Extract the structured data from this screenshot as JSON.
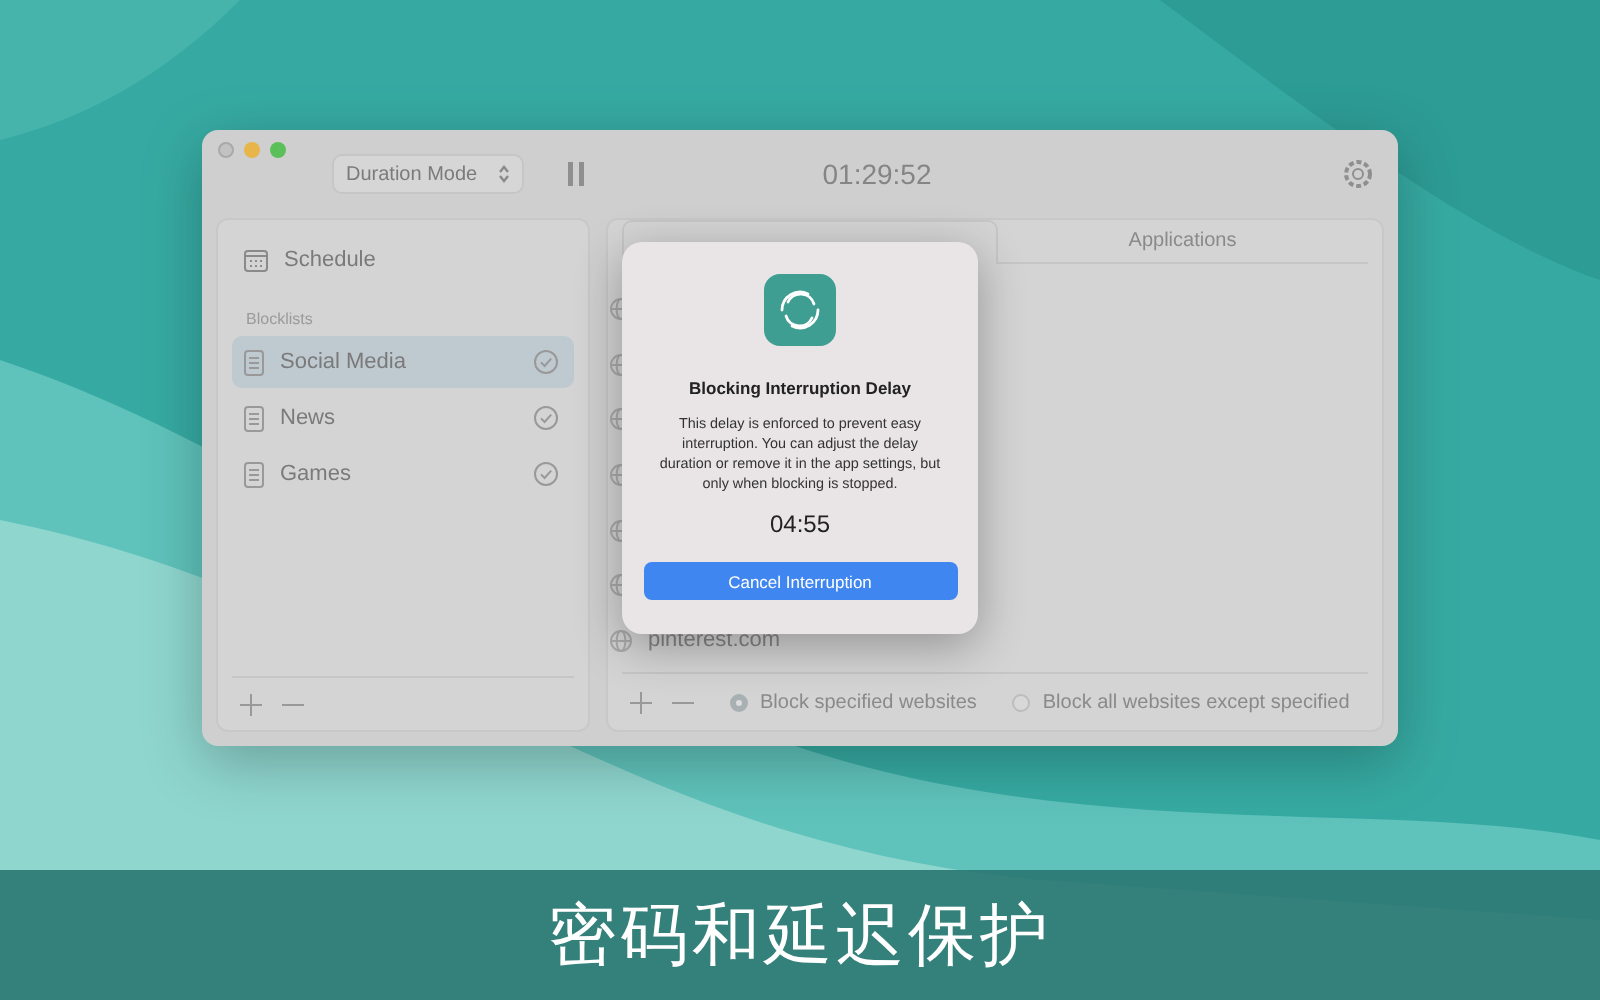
{
  "toolbar": {
    "mode": "Duration Mode",
    "timer": "01:29:52"
  },
  "sidebar": {
    "schedule": "Schedule",
    "section": "Blocklists",
    "items": [
      {
        "label": "Social Media",
        "selected": true,
        "enabled": true
      },
      {
        "label": "News",
        "selected": false,
        "enabled": true
      },
      {
        "label": "Games",
        "selected": false,
        "enabled": true
      }
    ]
  },
  "tabs": [
    {
      "selected": true
    },
    {
      "label": "Applications",
      "selected": false
    }
  ],
  "websites": [
    {
      "kind": "covered"
    },
    {
      "kind": "covered"
    },
    {
      "kind": "covered"
    },
    {
      "kind": "covered"
    },
    {
      "kind": "covered"
    },
    {
      "kind": "covered"
    },
    {
      "kind": "site",
      "name": "pinterest.com"
    }
  ],
  "block_options": [
    {
      "label": "Block specified websites",
      "selected": true
    },
    {
      "label": "Block all websites except specified",
      "selected": false
    }
  ],
  "dialog": {
    "title": "Blocking Interruption Delay",
    "message": "This delay is enforced to prevent easy interruption. You can adjust the delay duration or remove it in the app settings, but only when blocking is stopped.",
    "countdown": "04:55",
    "button": "Cancel Interruption"
  },
  "caption": "密码和延迟保护"
}
